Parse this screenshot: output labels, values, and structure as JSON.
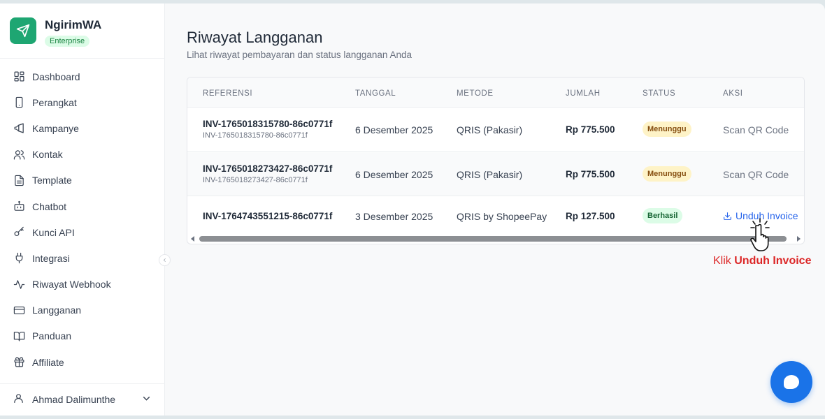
{
  "app": {
    "name": "NgirimWA",
    "plan_badge": "Enterprise"
  },
  "sidebar": {
    "items": [
      {
        "label": "Dashboard",
        "icon": "dashboard-icon"
      },
      {
        "label": "Perangkat",
        "icon": "device-icon"
      },
      {
        "label": "Kampanye",
        "icon": "megaphone-icon"
      },
      {
        "label": "Kontak",
        "icon": "contacts-icon"
      },
      {
        "label": "Template",
        "icon": "document-icon"
      },
      {
        "label": "Chatbot",
        "icon": "bot-icon"
      },
      {
        "label": "Kunci API",
        "icon": "key-icon"
      },
      {
        "label": "Integrasi",
        "icon": "plug-icon"
      },
      {
        "label": "Riwayat Webhook",
        "icon": "activity-icon"
      },
      {
        "label": "Langganan",
        "icon": "card-icon"
      },
      {
        "label": "Panduan",
        "icon": "book-icon"
      },
      {
        "label": "Affiliate",
        "icon": "gift-icon"
      }
    ],
    "user": {
      "name": "Ahmad Dalimunthe"
    }
  },
  "main": {
    "title": "Riwayat Langganan",
    "subtitle": "Lihat riwayat pembayaran dan status langganan Anda",
    "table": {
      "headers": [
        "REFERENSI",
        "TANGGAL",
        "METODE",
        "JUMLAH",
        "STATUS",
        "AKSI"
      ],
      "rows": [
        {
          "reference": "INV-1765018315780-86c0771f",
          "reference_sub": "INV-1765018315780-86c0771f",
          "date": "6 Desember 2025",
          "method": "QRIS (Pakasir)",
          "amount": "Rp 775.500",
          "status": "Menunggu",
          "action": "Scan QR Code"
        },
        {
          "reference": "INV-1765018273427-86c0771f",
          "reference_sub": "INV-1765018273427-86c0771f",
          "date": "6 Desember 2025",
          "method": "QRIS (Pakasir)",
          "amount": "Rp 775.500",
          "status": "Menunggu",
          "action": "Scan QR Code"
        },
        {
          "reference": "INV-1764743551215-86c0771f",
          "date": "3 Desember 2025",
          "method": "QRIS by ShopeePay",
          "amount": "Rp 127.500",
          "status": "Berhasil",
          "action": "Unduh Invoice"
        }
      ]
    }
  },
  "annotation": {
    "prefix": "Klik",
    "emphasis": "Unduh Invoice"
  },
  "colors": {
    "brand_green": "#1ea672",
    "link_blue": "#2563eb",
    "annotation_red": "#dc2626",
    "fab_blue": "#1a73e8"
  }
}
